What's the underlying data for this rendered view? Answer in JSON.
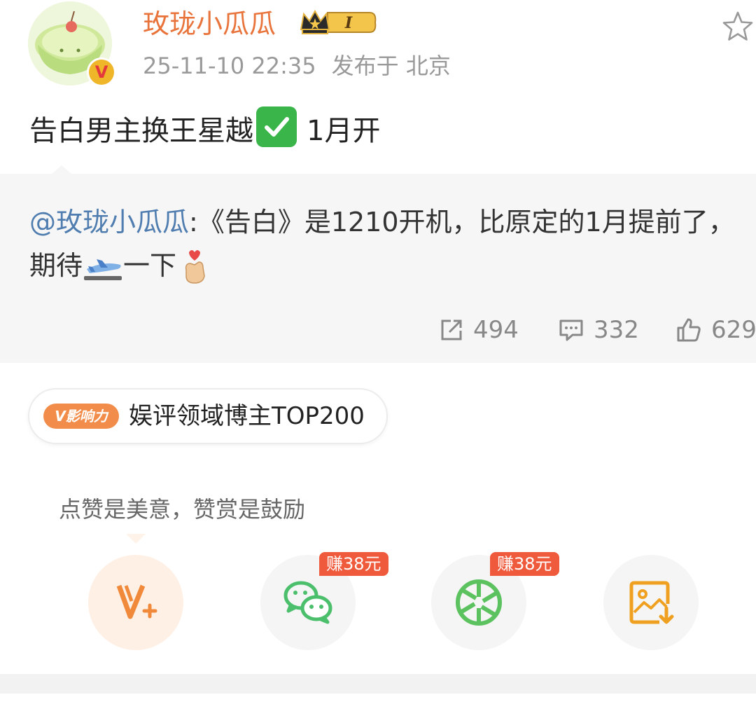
{
  "user": {
    "name": "玫珑小瓜瓜",
    "level_badge": "I",
    "verified_mark": "V",
    "time": "25-11-10 22:35",
    "location": "发布于 北京"
  },
  "post": {
    "text": "告白男主换王星越",
    "suffix": "1月开"
  },
  "repost": {
    "mention": "@玫珑小瓜瓜",
    "text_part1": ":《告白》是1210开机，比原定的1月提前了，期待",
    "text_part2": "一下"
  },
  "stats": {
    "reposts": "494",
    "comments": "332",
    "likes": "629"
  },
  "influence": {
    "badge": "V影响力",
    "label": "娱评领域博主TOP200"
  },
  "reward": {
    "tip": "点赞是美意，赞赏是鼓励",
    "earn_wechat": "赚38元",
    "earn_moments": "赚38元"
  },
  "icons": [
    "avatar-image",
    "crown-icon",
    "star-icon",
    "check-icon",
    "plane-icon",
    "hand-heart-icon",
    "repost-icon",
    "comment-icon",
    "like-icon",
    "v-plus-icon",
    "wechat-icon",
    "moments-icon",
    "save-image-icon"
  ],
  "colors": {
    "username": "#e8733b",
    "mention": "#507daf",
    "earn_badge": "#f05a3c",
    "influence_badge": "#f28c4a"
  }
}
